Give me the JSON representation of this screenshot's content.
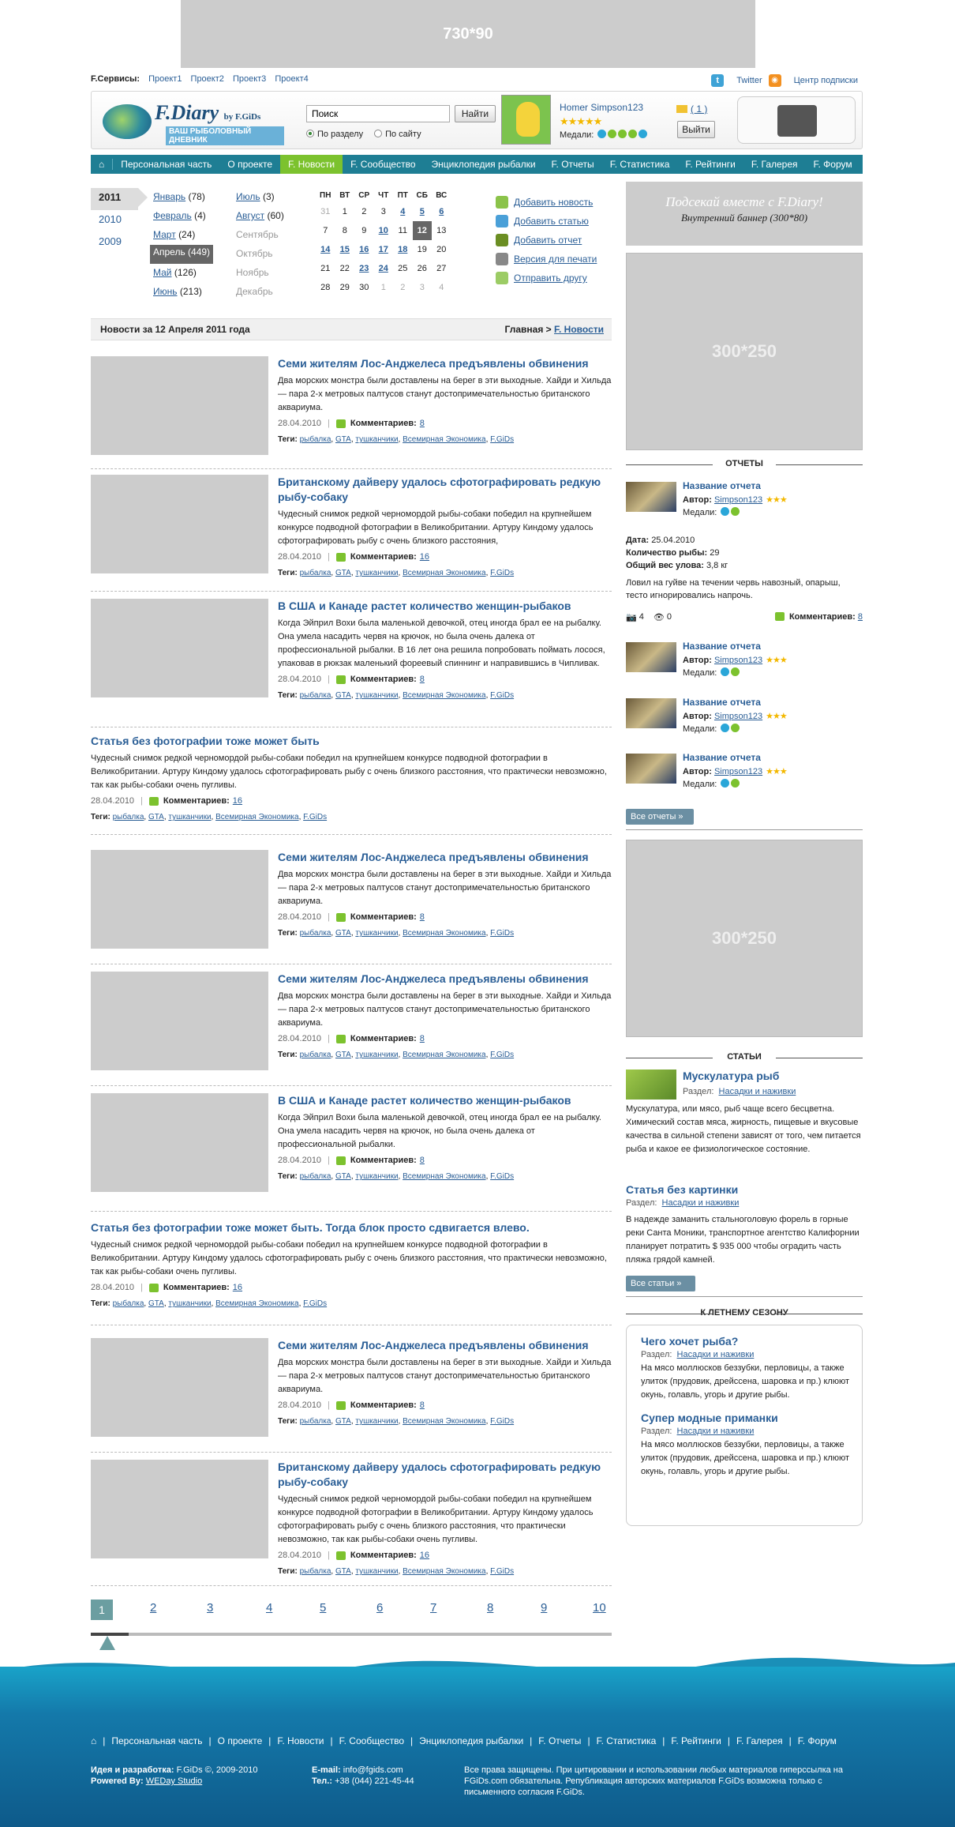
{
  "banner_top": "730*90",
  "services": {
    "label": "F.Сервисы:",
    "links": [
      "Проект1",
      "Проект2",
      "Проект3",
      "Проект4"
    ],
    "twitter": "Twitter",
    "subscribe": "Центр подписки"
  },
  "logo": {
    "title": "F.Diary",
    "by": "by F.GiDs",
    "subtitle": "ВАШ РЫБОЛОВНЫЙ ДНЕВНИК"
  },
  "search": {
    "value": "Поиск",
    "button": "Найти",
    "opt1": "По разделу",
    "opt2": "По сайту"
  },
  "user": {
    "name": "Homer Simpson123",
    "stars": "★★★★★",
    "medals_label": "Медали:",
    "mail": "( 1 )",
    "exit": "Выйти"
  },
  "nav": [
    "Персональная часть",
    "О проекте",
    "F. Новости",
    "F. Сообщество",
    "Энциклопедия рыбалки",
    "F. Отчеты",
    "F. Статистика",
    "F. Рейтинги",
    "F. Галерея",
    "F. Форум"
  ],
  "years": [
    "2011",
    "2010",
    "2009"
  ],
  "months": [
    {
      "name": "Январь",
      "count": "(78)"
    },
    {
      "name": "Февраль",
      "count": "(4)"
    },
    {
      "name": "Март",
      "count": "(24)"
    },
    {
      "name": "Апрель (449)",
      "count": ""
    },
    {
      "name": "Май",
      "count": "(126)"
    },
    {
      "name": "Июнь",
      "count": "(213)"
    },
    {
      "name": "Июль",
      "count": "(3)"
    },
    {
      "name": "Август",
      "count": "(60)"
    },
    {
      "name": "Сентябрь",
      "count": ""
    },
    {
      "name": "Октябрь",
      "count": ""
    },
    {
      "name": "Ноябрь",
      "count": ""
    },
    {
      "name": "Декабрь",
      "count": ""
    }
  ],
  "cal_days": [
    "ПН",
    "ВТ",
    "СР",
    "ЧТ",
    "ПТ",
    "СБ",
    "ВС"
  ],
  "cal_weeks": [
    [
      "31",
      "1",
      "2",
      "3",
      "4",
      "5",
      "6"
    ],
    [
      "7",
      "8",
      "9",
      "10",
      "11",
      "12",
      "13"
    ],
    [
      "14",
      "15",
      "16",
      "17",
      "18",
      "19",
      "20"
    ],
    [
      "21",
      "22",
      "23",
      "24",
      "25",
      "26",
      "27"
    ],
    [
      "28",
      "29",
      "30",
      "1",
      "2",
      "3",
      "4"
    ]
  ],
  "tools": [
    "Добавить новость",
    "Добавить статью",
    "Добавить отчет",
    "Версия для печати",
    "Отправить другу"
  ],
  "crumbs": {
    "left": "Новости за 12 Апреля 2011 года",
    "home": "Главная >",
    "current": "F. Новости"
  },
  "meta": {
    "date": "28.04.2010",
    "comments_label": "Комментариев:",
    "tags_label": "Теги:",
    "tags": [
      "рыбалка",
      "GTA",
      "тушканчики",
      "Всемирная Экономика",
      "F.GiDs"
    ]
  },
  "articles": [
    {
      "title": "Семи жителям Лос-Анджелеса предъявлены обвинения",
      "text": "Два морских монстра были доставлены на берег в эти выходные. Хайди и Хильда — пара 2-х метровых палтусов станут достопримечательностью британского аквариума.",
      "comments": "8"
    },
    {
      "title": "Британскому дайверу удалось сфотографировать редкую рыбу-собаку",
      "text": "Чудесный снимок редкой черномордой рыбы-собаки победил на крупнейшем конкурсе подводной фотографии в Великобритании. Артуру Киндому удалось сфотографировать рыбу с очень близкого расстояния,",
      "comments": "16"
    },
    {
      "title": "В США и Канаде растет количество женщин-рыбаков",
      "text": "Когда Эйприл Вохи была маленькой девочкой, отец иногда брал ее на рыбалку. Она умела насадить червя на крючок, но была очень далека от профессиональной рыбалки. В 16 лет она решила попробовать поймать лосося, упаковав в рюкзак маленький фореевый спиннинг и направившись в Чипливак.",
      "comments": "8"
    },
    {
      "title": "Статья без фотографии тоже может быть",
      "text": "Чудесный снимок редкой черномордой рыбы-собаки победил на крупнейшем конкурсе подводной фотографии в Великобритании. Артуру Киндому удалось сфотографировать рыбу с очень близкого расстояния, что практически невозможно, так как рыбы-собаки очень пугливы.",
      "comments": "16"
    },
    {
      "title": "Семи жителям Лос-Анджелеса предъявлены обвинения",
      "text": "Два морских монстра были доставлены на берег в эти выходные. Хайди и Хильда — пара 2-х метровых палтусов станут достопримечательностью британского аквариума.",
      "comments": "8"
    },
    {
      "title": "Семи жителям Лос-Анджелеса предъявлены обвинения",
      "text": "Два морских монстра были доставлены на берег в эти выходные. Хайди и Хильда — пара 2-х метровых палтусов станут достопримечательностью британского аквариума.",
      "comments": "8"
    },
    {
      "title": "В США и Канаде растет количество женщин-рыбаков",
      "text": "Когда Эйприл Вохи была маленькой девочкой, отец иногда брал ее на рыбалку. Она умела насадить червя на крючок, но была очень далека от профессиональной рыбалки.",
      "comments": "8"
    },
    {
      "title": "Статья без фотографии тоже может быть. Тогда блок просто сдвигается влево.",
      "text": "Чудесный снимок редкой черномордой рыбы-собаки победил на крупнейшем конкурсе подводной фотографии в Великобритании. Артуру Киндому удалось сфотографировать рыбу с очень близкого расстояния, что практически невозможно, так как рыбы-собаки очень пугливы.",
      "comments": "16"
    },
    {
      "title": "Семи жителям Лос-Анджелеса предъявлены обвинения",
      "text": "Два морских монстра были доставлены на берег в эти выходные. Хайди и Хильда — пара 2-х метровых палтусов станут достопримечательностью британского аквариума.",
      "comments": "8"
    },
    {
      "title": "Британскому дайверу удалось сфотографировать редкую рыбу-собаку",
      "text": "Чудесный снимок редкой черномордой рыбы-собаки победил на крупнейшем конкурсе подводной фотографии в Великобритании. Артуру Киндому удалось сфотографировать рыбу с очень близкого расстояния, что практически невозможно, так как рыбы-собаки очень пугливы.",
      "comments": "16"
    }
  ],
  "pager": [
    "1",
    "2",
    "3",
    "4",
    "5",
    "6",
    "7",
    "8",
    "9",
    "10"
  ],
  "sidebar": {
    "banner_inner_a": "Подсекай вместе с F.Diary!",
    "banner_inner_b": "Внутренний баннер (300*80)",
    "b300": "300*250",
    "reports_head": "ОТЧЕТЫ",
    "report_title": "Название отчета",
    "author_label": "Автор:",
    "author": "Simpson123",
    "medals_label": "Медали:",
    "stars": "★★★",
    "info_date_l": "Дата:",
    "info_date": "25.04.2010",
    "info_count_l": "Количество рыбы:",
    "info_count": "29",
    "info_weight_l": "Общий вес улова:",
    "info_weight": "3,8 кг",
    "info_text": "Ловил на гуйве на течении червь навозный, опарыш, тесто игнорировались напрочь.",
    "photos": "4",
    "views": "0",
    "comments_label": "Комментариев:",
    "comments": "8",
    "all_reports": "Все отчеты",
    "articles_head": "СТАТЬИ",
    "a1_title": "Мускулатура рыб",
    "section_label": "Раздел:",
    "section": "Насадки и наживки",
    "a1_text": "Мускулатура, или мясо, рыб чаще всего бесцветна. Химический состав мяса, жирность, пищевые и вкусовые качества в сильной степени зависят от того, чем питается рыба и какое ее физиологическое состояние.",
    "a2_title": "Статья без картинки",
    "a2_text": "В надежде заманить стальноголовую форель в горные реки Санта Моники, транспортное агентство Калифорнии планирует потратить $ 935 000 чтобы оградить часть пляжа грядой камней.",
    "all_articles": "Все статьи",
    "summer_head": "К ЛЕТНЕМУ СЕЗОНУ",
    "s1_title": "Чего хочет рыба?",
    "s2_title": "Супер модные приманки",
    "s_text": "На мясо моллюсков беззубки, перловицы, а также улиток (прудовик, дрейссена, шаровка и пр.) клюют окунь, голавль, угорь и другие рыбы."
  },
  "footer": {
    "nav": [
      "Персональная часть",
      "О проекте",
      "F. Новости",
      "F. Сообщество",
      "Энциклопедия рыбалки",
      "F. Отчеты",
      "F. Статистика",
      "F. Рейтинги",
      "F. Галерея",
      "F. Форум"
    ],
    "idea_l": "Идея и разработка:",
    "idea": "F.GiDs ©, 2009-2010",
    "powered_l": "Powered By:",
    "powered": "WEDay Studio",
    "email_l": "E-mail:",
    "email": "info@fgids.com",
    "tel_l": "Тел.:",
    "tel": "+38 (044) 221-45-44",
    "rights": "Все права защищены. При цитировании и использовании любых материалов гиперссылка на FGiDs.com обязательна. Републикация авторских материалов F.GiDs возможна только с письменного согласия F.GiDs."
  }
}
